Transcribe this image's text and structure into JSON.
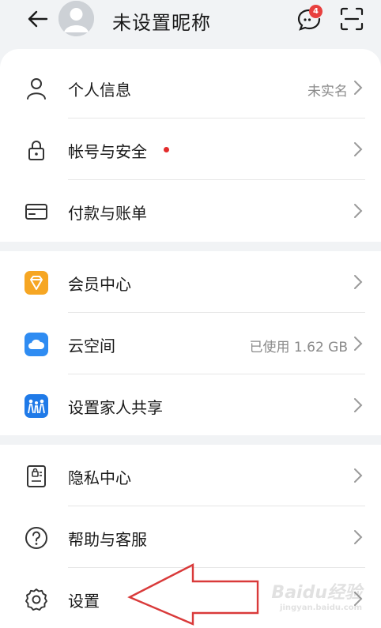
{
  "header": {
    "nickname": "未设置昵称",
    "message_badge": "4"
  },
  "section1": {
    "personal_info": {
      "label": "个人信息",
      "value": "未实名"
    },
    "account_security": {
      "label": "帐号与安全"
    },
    "payment_bills": {
      "label": "付款与账单"
    }
  },
  "section2": {
    "membership": {
      "label": "会员中心"
    },
    "cloud": {
      "label": "云空间",
      "value": "已使用 1.62 GB"
    },
    "family_share": {
      "label": "设置家人共享"
    }
  },
  "section3": {
    "privacy": {
      "label": "隐私中心"
    },
    "help": {
      "label": "帮助与客服"
    },
    "settings": {
      "label": "设置"
    }
  },
  "watermark": {
    "brand": "Baidu经验",
    "url": "jingyan.baidu.com"
  },
  "colors": {
    "accent_red": "#e32c2c",
    "vip_orange": "#f6a623",
    "cloud_blue": "#2f8cf2",
    "family_blue": "#1f7ae8",
    "annotation_arrow": "#d93a3a"
  }
}
